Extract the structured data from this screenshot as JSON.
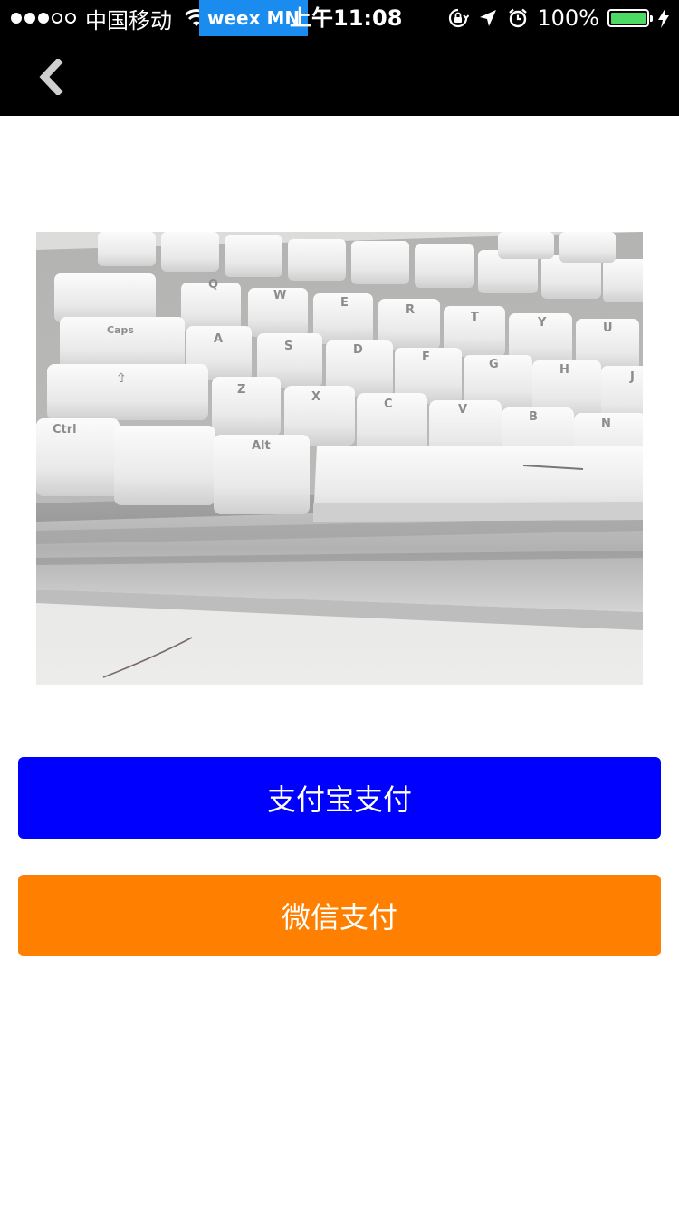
{
  "status_bar": {
    "carrier": "中国移动",
    "debug_label": "weex MN",
    "time": "上午11:08",
    "battery_percent": "100%",
    "battery_level": 1.0,
    "icons": [
      "signal-dots-icon",
      "wifi-icon",
      "rotation-lock-icon",
      "location-arrow-icon",
      "alarm-icon",
      "battery-icon",
      "charging-bolt-icon"
    ]
  },
  "nav": {
    "back_icon": "chevron-left-icon"
  },
  "image": {
    "alt_subject": "keyboard-photo"
  },
  "actions": {
    "alipay_label": "支付宝支付",
    "wechat_label": "微信支付"
  },
  "colors": {
    "status_bar_bg": "#000000",
    "nav_bg": "#000000",
    "debug_badge": "#1a8cf0",
    "alipay_button": "#0000ff",
    "wechat_button": "#ff8000",
    "battery_fill": "#4cd964",
    "back_icon": "#cfcfcf"
  }
}
